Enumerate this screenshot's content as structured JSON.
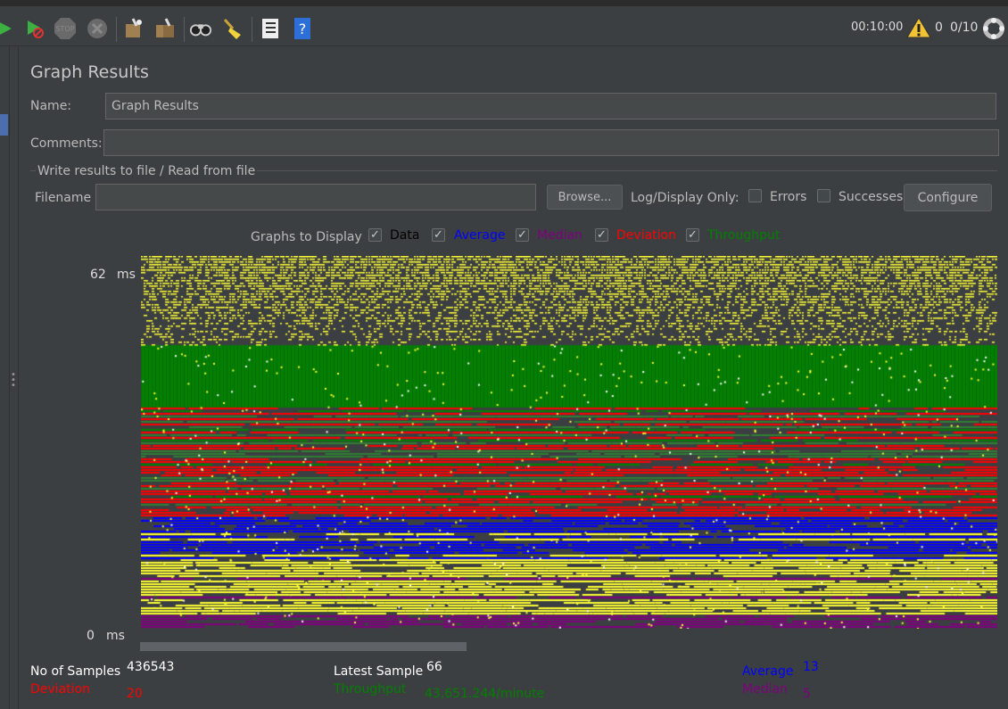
{
  "toolbar": {
    "timer": "00:10:00",
    "warning_count": "0",
    "threads": "0/10",
    "icons": [
      "start-icon",
      "start-no-timers-icon",
      "stop-icon",
      "shutdown-icon",
      "clear-icon",
      "clear-all-icon",
      "search-icon",
      "reset-search-icon",
      "function-helper-icon",
      "help-icon"
    ]
  },
  "panel": {
    "title": "Graph Results",
    "name_label": "Name:",
    "name_value": "Graph Results",
    "comments_label": "Comments:",
    "comments_value": "",
    "file_section_title": "Write results to file / Read from file",
    "filename_label": "Filename",
    "filename_value": "",
    "browse_label": "Browse...",
    "log_display_label": "Log/Display Only:",
    "errors_label": "Errors",
    "successes_label": "Successes",
    "configure_label": "Configure"
  },
  "graphs_to_display": {
    "label": "Graphs to Display",
    "options": [
      {
        "label": "Data",
        "checked": true,
        "color": "#000000"
      },
      {
        "label": "Average",
        "checked": true,
        "color": "#0000ff"
      },
      {
        "label": "Median",
        "checked": true,
        "color": "#800080"
      },
      {
        "label": "Deviation",
        "checked": true,
        "color": "#ff0000"
      },
      {
        "label": "Throughput",
        "checked": true,
        "color": "#008000"
      }
    ]
  },
  "graph": {
    "y_max": "62",
    "y_min": "0",
    "y_unit": "ms",
    "colors": {
      "data": "#ffff33",
      "average": "#0000ff",
      "median": "#800080",
      "deviation": "#ff0000",
      "throughput": "#008000"
    }
  },
  "stats": {
    "samples_label": "No of Samples",
    "samples_value": "436543",
    "latest_label": "Latest Sample",
    "latest_value": "66",
    "average_label": "Average",
    "average_value": "13",
    "deviation_label": "Deviation",
    "deviation_value": "20",
    "throughput_label": "Throughput",
    "throughput_value": "43,651.244/minute",
    "median_label": "Median",
    "median_value": "5"
  }
}
